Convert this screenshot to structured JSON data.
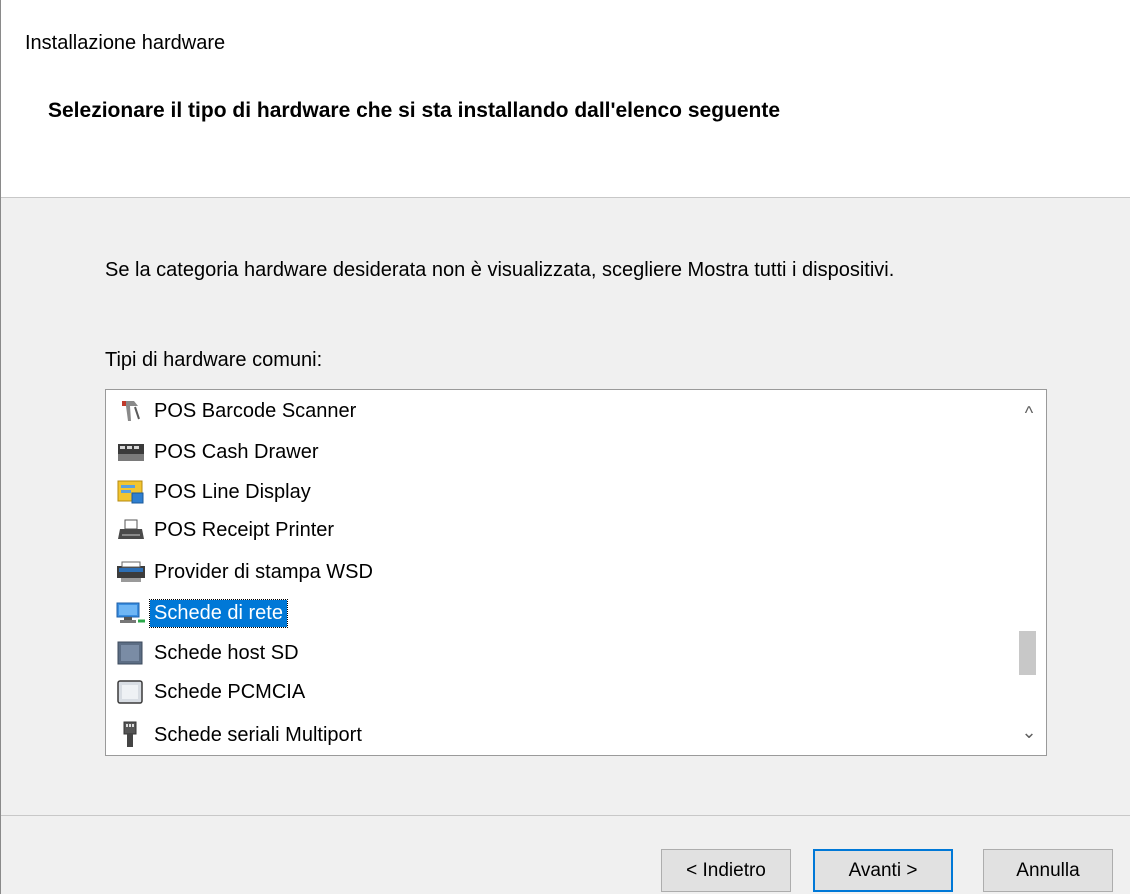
{
  "window": {
    "title": "Installazione hardware"
  },
  "header": {
    "heading": "Selezionare il tipo di hardware che si sta installando dall'elenco seguente"
  },
  "content": {
    "instruction": "Se la categoria hardware desiderata non è visualizzata, scegliere Mostra tutti i dispositivi.",
    "list_label": "Tipi di hardware comuni:"
  },
  "list": {
    "items": [
      {
        "label": "POS Barcode Scanner",
        "icon": "barcode-scanner-icon"
      },
      {
        "label": "POS Cash Drawer",
        "icon": "cash-drawer-icon"
      },
      {
        "label": "POS Line Display",
        "icon": "line-display-icon"
      },
      {
        "label": "POS Receipt Printer",
        "icon": "receipt-printer-icon"
      },
      {
        "label": "Provider di stampa WSD",
        "icon": "wsd-printer-icon"
      },
      {
        "label": "Schede di rete",
        "icon": "network-adapter-icon",
        "selected": true
      },
      {
        "label": "Schede host SD",
        "icon": "sd-host-icon"
      },
      {
        "label": "Schede PCMCIA",
        "icon": "pcmcia-icon"
      },
      {
        "label": "Schede seriali Multiport",
        "icon": "serial-port-icon"
      }
    ],
    "selection_color": "#0078d7"
  },
  "scrollbar": {
    "up_glyph": "^",
    "down_glyph": "⌄"
  },
  "buttons": {
    "back": "< Indietro",
    "next": "Avanti >",
    "cancel": "Annulla"
  }
}
